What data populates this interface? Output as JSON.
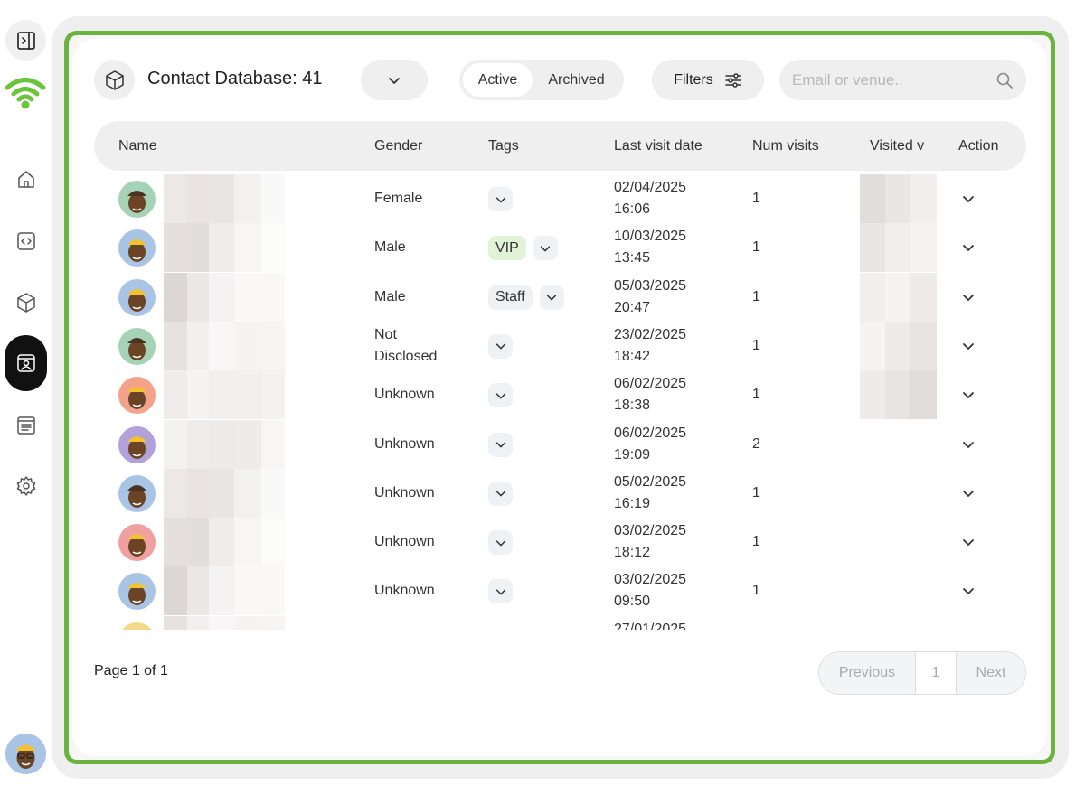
{
  "header": {
    "title": "Contact Database: 41",
    "segment": {
      "active_label": "Active",
      "archived_label": "Archived"
    },
    "filters_label": "Filters",
    "search_placeholder": "Email or venue.."
  },
  "table": {
    "columns": [
      "Name",
      "Gender",
      "Tags",
      "Last visit date",
      "Num visits",
      "Visited v",
      "Action"
    ],
    "rows": [
      {
        "gender": "Female",
        "tags": [],
        "date": "02/04/2025",
        "time": "16:06",
        "visits": "1",
        "avatar_color": "#a6d3b8"
      },
      {
        "gender": "Male",
        "tags": [
          "VIP"
        ],
        "date": "10/03/2025",
        "time": "13:45",
        "visits": "1",
        "avatar_color": "#a9c4e4"
      },
      {
        "gender": "Male",
        "tags": [
          "Staff"
        ],
        "date": "05/03/2025",
        "time": "20:47",
        "visits": "1",
        "avatar_color": "#a9c4e4"
      },
      {
        "gender": "Not",
        "gender2": "Disclosed",
        "tags": [],
        "date": "23/02/2025",
        "time": "18:42",
        "visits": "1",
        "avatar_color": "#a6d3b8"
      },
      {
        "gender": "Unknown",
        "tags": [],
        "date": "06/02/2025",
        "time": "18:38",
        "visits": "1",
        "avatar_color": "#f3a38c"
      },
      {
        "gender": "Unknown",
        "tags": [],
        "date": "06/02/2025",
        "time": "19:09",
        "visits": "2",
        "avatar_color": "#b3a1da"
      },
      {
        "gender": "Unknown",
        "tags": [],
        "date": "05/02/2025",
        "time": "16:19",
        "visits": "1",
        "avatar_color": "#a9c4e4"
      },
      {
        "gender": "Unknown",
        "tags": [],
        "date": "03/02/2025",
        "time": "18:12",
        "visits": "1",
        "avatar_color": "#f0a0a0"
      },
      {
        "gender": "Unknown",
        "tags": [],
        "date": "03/02/2025",
        "time": "09:50",
        "visits": "1",
        "avatar_color": "#a9c4e4"
      },
      {
        "gender": "",
        "tags": [],
        "date": "27/01/2025",
        "time": "",
        "visits": "",
        "avatar_color": "#f5d98a"
      }
    ]
  },
  "footer": {
    "page_label": "Page 1 of 1",
    "previous_label": "Previous",
    "page_number": "1",
    "next_label": "Next"
  },
  "colors": {
    "accent_green": "#69b33e",
    "vip_tag": "#e2f2d6",
    "sidebar_active": "#111111"
  },
  "icons": [
    "sidebar-toggle-icon",
    "wifi-logo-icon",
    "home-icon",
    "code-icon",
    "cube-icon",
    "contacts-icon",
    "list-icon",
    "gear-icon",
    "search-icon",
    "filter-sliders-icon",
    "chevron-down-icon"
  ]
}
